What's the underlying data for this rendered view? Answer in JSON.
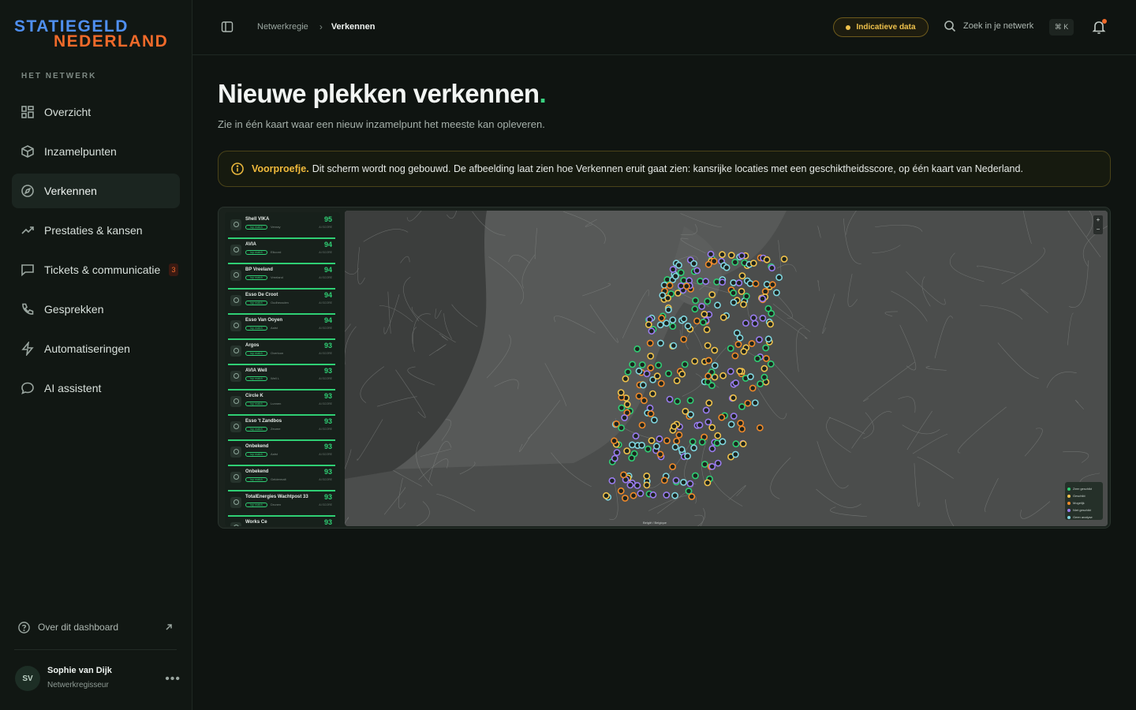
{
  "brand": {
    "line1": "STATIEGELD",
    "line2": "NEDERLAND"
  },
  "sidebar": {
    "section_label": "HET NETWERK",
    "items": [
      {
        "label": "Overzicht",
        "icon": "grid-icon"
      },
      {
        "label": "Inzamelpunten",
        "icon": "box-icon"
      },
      {
        "label": "Verkennen",
        "icon": "compass-icon",
        "active": true
      },
      {
        "label": "Prestaties & kansen",
        "icon": "trend-icon"
      },
      {
        "label": "Tickets & communicatie",
        "icon": "chat-square-icon",
        "badge": "3"
      },
      {
        "label": "Gesprekken",
        "icon": "phone-icon"
      },
      {
        "label": "Automatiseringen",
        "icon": "bolt-icon"
      },
      {
        "label": "AI assistent",
        "icon": "chat-bubble-icon"
      }
    ],
    "about_label": "Over dit dashboard",
    "user": {
      "initials": "SV",
      "name": "Sophie van Dijk",
      "role": "Netwerkregisseur"
    }
  },
  "topbar": {
    "breadcrumb": [
      "Netwerkregie",
      "Verkennen"
    ],
    "data_pill": "Indicatieve data",
    "search_placeholder": "Zoek in je netwerk",
    "shortcut": "⌘ K"
  },
  "page": {
    "title": "Nieuwe plekken verkennen",
    "title_period": ".",
    "subtitle": "Zie in één kaart waar een nieuw inzamelpunt het meeste kan opleveren.",
    "notice_lead": "Voorproefje.",
    "notice_text": "Dit scherm wordt nog gebouwd. De afbeelding laat zien hoe Verkennen eruit gaat zien: kansrijke locaties met een geschiktheidsscore, op één kaart van Nederland."
  },
  "preview": {
    "tag": "top match",
    "score_label": "AI SCORE",
    "locations": [
      {
        "name": "Shell VIKA",
        "place": "Venray",
        "score": "95"
      },
      {
        "name": "AVIA",
        "place": "Elkcord",
        "score": "94"
      },
      {
        "name": "BP Vreeland",
        "place": "Vreeland",
        "score": "94"
      },
      {
        "name": "Esso De Croot",
        "place": "Oudheusden",
        "score": "94"
      },
      {
        "name": "Esso Van Ooyen",
        "place": "Aalst",
        "score": "94"
      },
      {
        "name": "Argos",
        "place": "Overloon",
        "score": "93"
      },
      {
        "name": "AVIA Well",
        "place": "Well L",
        "score": "93"
      },
      {
        "name": "Circle K",
        "place": "Lunnen",
        "score": "93"
      },
      {
        "name": "Esso 't Zandbos",
        "place": "Zeume",
        "score": "93"
      },
      {
        "name": "Onbekend",
        "place": "Aalst",
        "score": "93"
      },
      {
        "name": "Onbekend",
        "place": "Geldermalt",
        "score": "93"
      },
      {
        "name": "TotalEnergies Wachtpost 33",
        "place": "Drunen",
        "score": "93"
      },
      {
        "name": "Works Ce",
        "place": "",
        "score": "93"
      }
    ],
    "legend": [
      {
        "label": "Zeer geschikt",
        "color": "#2fcf74"
      },
      {
        "label": "Geschikt",
        "color": "#f0c24c"
      },
      {
        "label": "Mogelijk",
        "color": "#f08a2a"
      },
      {
        "label": "Niet geschikt",
        "color": "#9a7cf0"
      },
      {
        "label": "Geen analyse",
        "color": "#7fd6e0"
      }
    ],
    "zoom_in": "+",
    "zoom_out": "−",
    "country_label": "België / Belgique"
  },
  "colors": {
    "accent": "#39d07f",
    "brand_blue": "#4f8ff0",
    "brand_orange": "#f06a2a",
    "warning": "#f0b93b"
  }
}
